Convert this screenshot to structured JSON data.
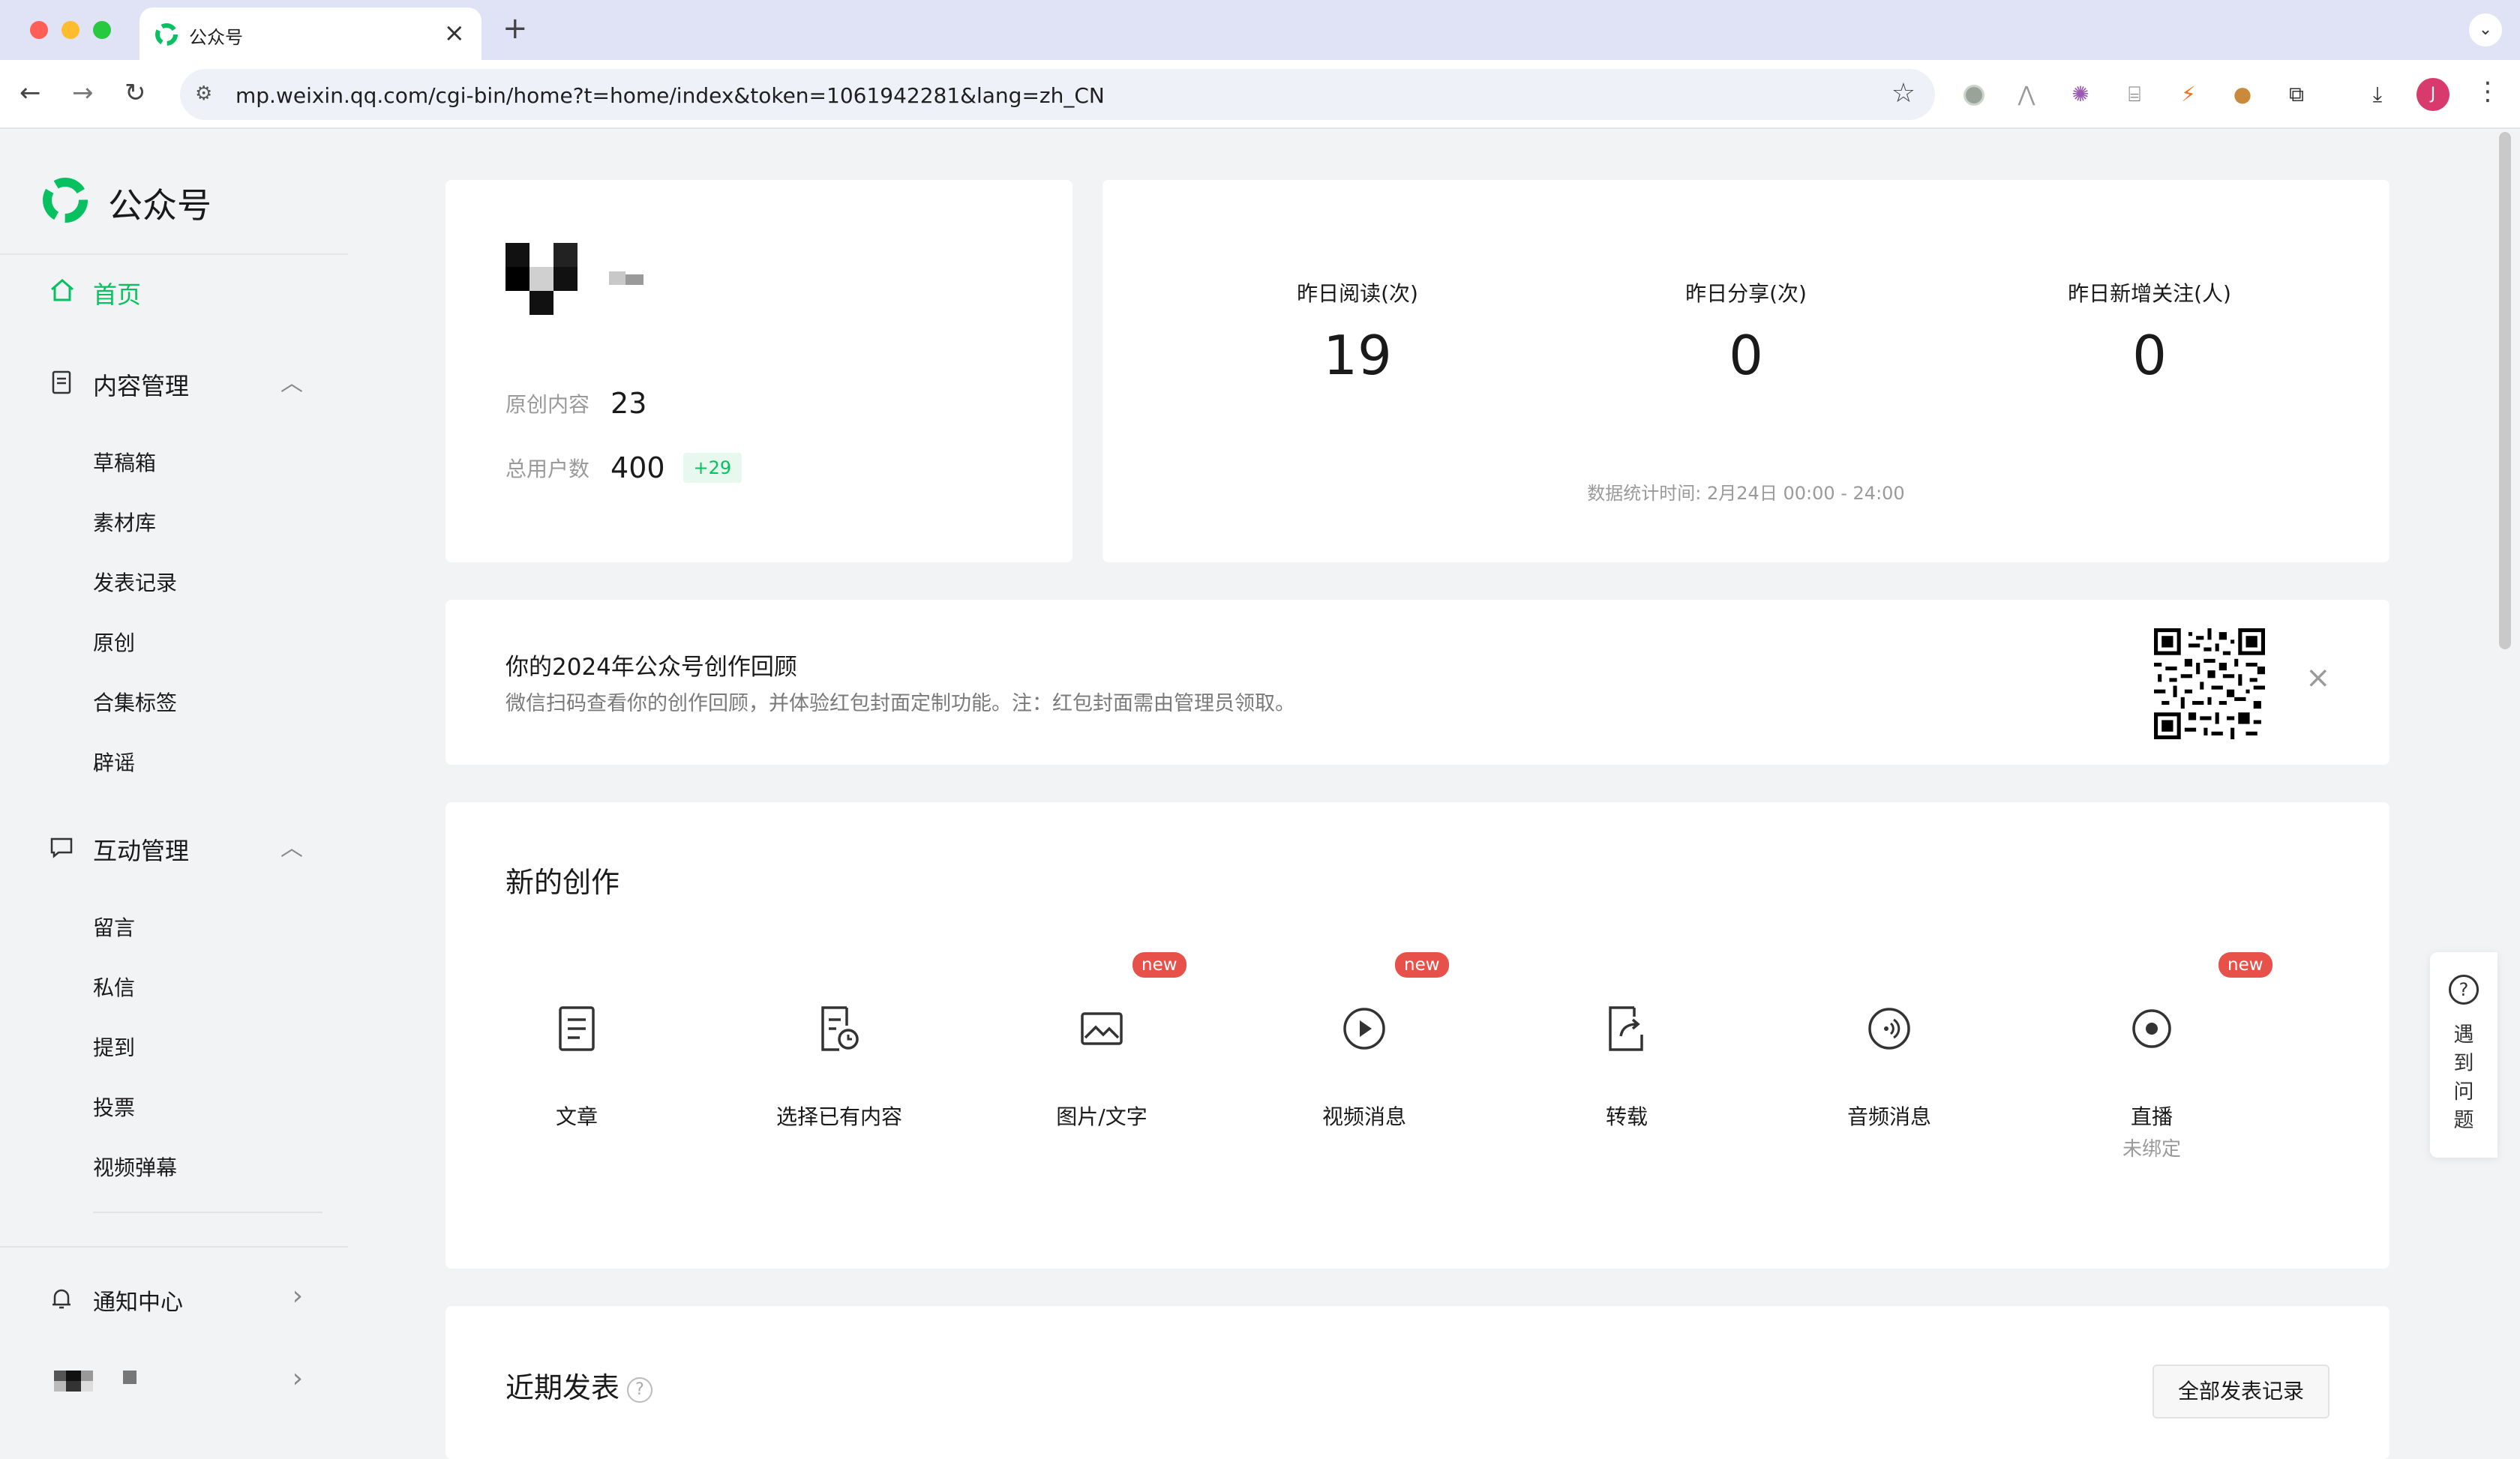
{
  "browser": {
    "tab_title": "公众号",
    "tab_close": "×",
    "new_tab": "+",
    "tab_menu": "⌄",
    "url": "mp.weixin.qq.com/cgi-bin/home?t=home/index&token=1061942281&lang=zh_CN",
    "profile_initial": "J",
    "extensions": [
      "grey-circle-icon",
      "perplexity-icon",
      "openai-icon",
      "translate-icon",
      "bolt-icon",
      "cookie-icon",
      "puzzle-icon",
      "download-icon"
    ]
  },
  "sidebar": {
    "brand": "公众号",
    "home": "首页",
    "content_group": {
      "label": "内容管理",
      "items": [
        "草稿箱",
        "素材库",
        "发表记录",
        "原创",
        "合集标签",
        "辟谣"
      ]
    },
    "interaction_group": {
      "label": "互动管理",
      "items": [
        "留言",
        "私信",
        "提到",
        "投票",
        "视频弹幕"
      ]
    },
    "notice": "通知中心"
  },
  "profile": {
    "original_label": "原创内容",
    "original_value": "23",
    "users_label": "总用户数",
    "users_value": "400",
    "users_delta": "+29"
  },
  "stats": {
    "metrics": [
      {
        "label": "昨日阅读(次)",
        "value": "19"
      },
      {
        "label": "昨日分享(次)",
        "value": "0"
      },
      {
        "label": "昨日新增关注(人)",
        "value": "0"
      }
    ],
    "time": "数据统计时间: 2月24日 00:00 - 24:00"
  },
  "review_banner": {
    "title": "你的2024年公众号创作回顾",
    "desc": "微信扫码查看你的创作回顾，并体验红包封面定制功能。注：红包封面需由管理员领取。",
    "close": "×"
  },
  "create": {
    "title": "新的创作",
    "items": [
      {
        "label": "文章",
        "icon": "article-icon",
        "badge": ""
      },
      {
        "label": "选择已有内容",
        "icon": "existing-content-icon",
        "badge": ""
      },
      {
        "label": "图片/文字",
        "icon": "image-text-icon",
        "badge": "new"
      },
      {
        "label": "视频消息",
        "icon": "video-icon",
        "badge": "new"
      },
      {
        "label": "转载",
        "icon": "repost-icon",
        "badge": ""
      },
      {
        "label": "音频消息",
        "icon": "audio-icon",
        "badge": ""
      },
      {
        "label": "直播",
        "icon": "live-icon",
        "badge": "new",
        "sub": "未绑定"
      }
    ]
  },
  "recent": {
    "title": "近期发表",
    "help": "?",
    "all_button": "全部发表记录"
  },
  "help_float": {
    "icon": "?",
    "text": "遇到问题"
  },
  "colors": {
    "accent": "#07c160",
    "badge_red": "#e8504a",
    "page_bg": "#f2f3f5"
  }
}
